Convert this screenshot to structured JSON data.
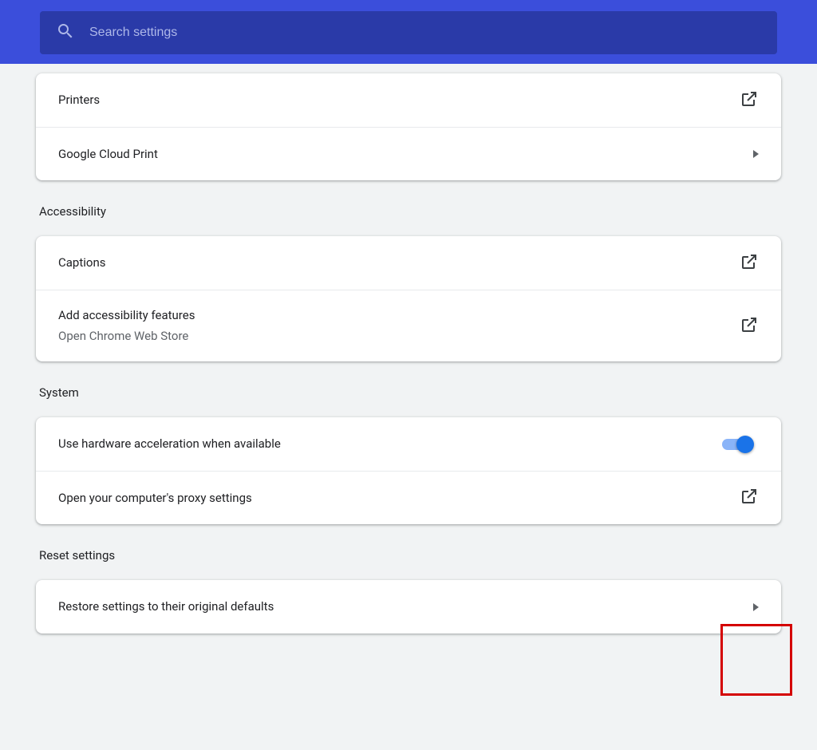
{
  "header": {
    "search_placeholder": "Search settings"
  },
  "printing": {
    "rows": [
      {
        "title": "Printers",
        "icon": "external"
      },
      {
        "title": "Google Cloud Print",
        "icon": "chevron"
      }
    ]
  },
  "accessibility": {
    "header": "Accessibility",
    "rows": [
      {
        "title": "Captions",
        "icon": "external"
      },
      {
        "title": "Add accessibility features",
        "subtitle": "Open Chrome Web Store",
        "icon": "external"
      }
    ]
  },
  "system": {
    "header": "System",
    "rows": [
      {
        "title": "Use hardware acceleration when available",
        "toggle": true
      },
      {
        "title": "Open your computer's proxy settings",
        "icon": "external"
      }
    ]
  },
  "reset": {
    "header": "Reset settings",
    "rows": [
      {
        "title": "Restore settings to their original defaults",
        "icon": "chevron"
      }
    ]
  }
}
